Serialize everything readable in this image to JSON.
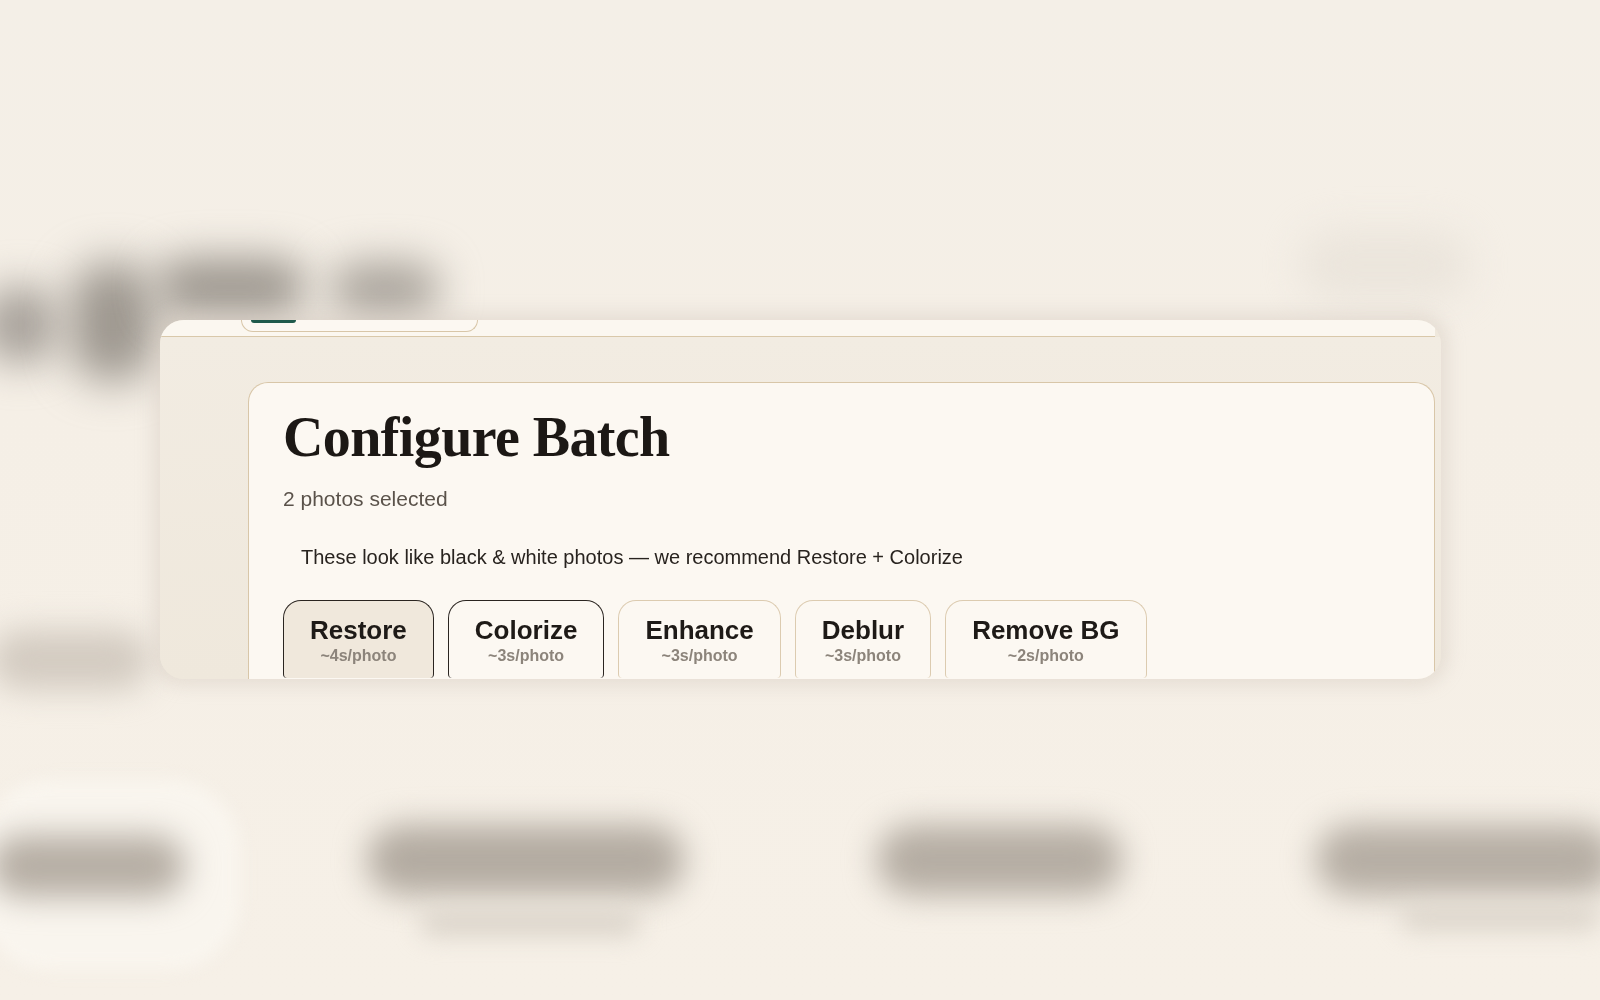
{
  "card": {
    "title": "Configure Batch",
    "subtitle": "2 photos selected",
    "recommendation": "These look like black & white photos — we recommend Restore + Colorize"
  },
  "operations": [
    {
      "label": "Restore",
      "time": "~4s/photo",
      "selected": true,
      "hovered": true
    },
    {
      "label": "Colorize",
      "time": "~3s/photo",
      "selected": true,
      "hovered": false
    },
    {
      "label": "Enhance",
      "time": "~3s/photo",
      "selected": false,
      "hovered": false
    },
    {
      "label": "Deblur",
      "time": "~3s/photo",
      "selected": false,
      "hovered": false
    },
    {
      "label": "Remove BG",
      "time": "~2s/photo",
      "selected": false,
      "hovered": false
    }
  ]
}
